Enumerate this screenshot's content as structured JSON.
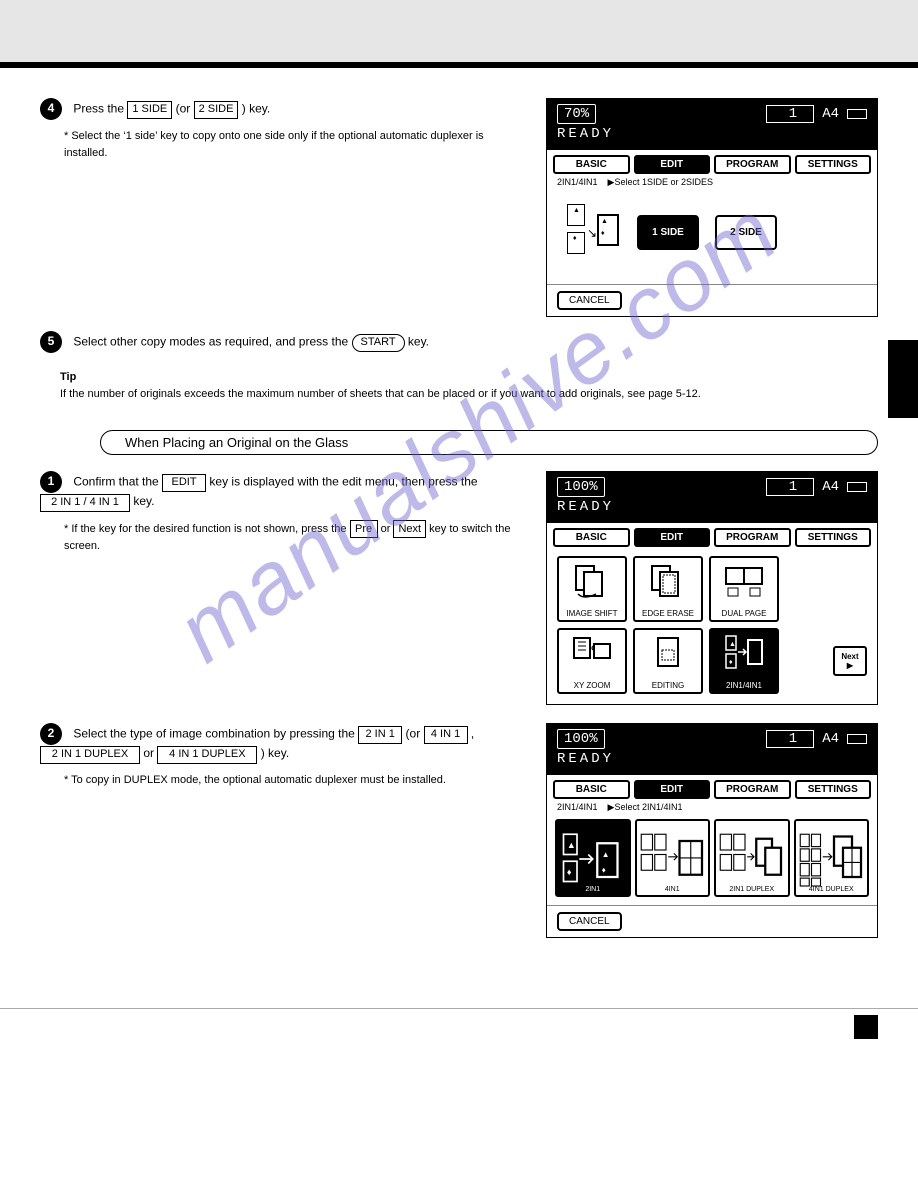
{
  "watermark": "manualshive.com",
  "header": {},
  "panel1": {
    "zoom": "70%",
    "count": "1",
    "paper": "A4",
    "ready": "READY",
    "tabs": {
      "basic": "BASIC",
      "edit": "EDIT",
      "program": "PROGRAM",
      "settings": "SETTINGS"
    },
    "mode_label": "2IN1/4IN1",
    "prompt": "▶Select 1SIDE or 2SIDES",
    "side1": "1 SIDE",
    "side2": "2 SIDE",
    "cancel": "CANCEL"
  },
  "panel2": {
    "zoom": "100%",
    "count": "1",
    "paper": "A4",
    "ready": "READY",
    "tabs": {
      "basic": "BASIC",
      "edit": "EDIT",
      "program": "PROGRAM",
      "settings": "SETTINGS"
    },
    "items": {
      "image_shift": "IMAGE SHIFT",
      "edge_erase": "EDGE ERASE",
      "dual_page": "DUAL PAGE",
      "xy_zoom": "XY ZOOM",
      "editing": "EDITING",
      "n2in1": "2IN1/4IN1"
    },
    "next": "Next"
  },
  "panel3": {
    "zoom": "100%",
    "count": "1",
    "paper": "A4",
    "ready": "READY",
    "tabs": {
      "basic": "BASIC",
      "edit": "EDIT",
      "program": "PROGRAM",
      "settings": "SETTINGS"
    },
    "mode_label": "2IN1/4IN1",
    "prompt": "▶Select 2IN1/4IN1",
    "modes": {
      "m2in1": "2IN1",
      "m4in1": "4IN1",
      "m2in1d": "2IN1 DUPLEX",
      "m4in1d": "4IN1 DUPLEX"
    },
    "cancel": "CANCEL"
  },
  "text": {
    "step4_a": "Press the ",
    "step4_key1": "1 SIDE",
    "step4_b": " (or ",
    "step4_key2": "2 SIDE",
    "step4_c": " ) key.",
    "step4_note": "* Select the ‘1 side’ key to copy onto one side only if the optional automatic duplexer is installed.",
    "step5_a": "Select other copy modes as required, and press the ",
    "step5_key": "START",
    "step5_b": " key.",
    "tip_head": "Tip",
    "tip_body": "If the number of originals exceeds the maximum number of sheets that can be placed or if you want to add originals, see page 5-12.",
    "subhead": "When Placing an Original on the Glass",
    "step1_a": "Confirm that the ",
    "step1_key1": "EDIT",
    "step1_b": " key is displayed with the edit menu, then press the ",
    "step1_key2": "2 IN 1 / 4 IN 1",
    "step1_c": " key.",
    "step1_note_a": "* If the key for the desired function is not shown, press the ",
    "step1_note_key1": "Pre",
    "step1_note_b": " or ",
    "step1_note_key2": "Next",
    "step1_note_c": " key to switch the screen.",
    "step2_a": "Select the type of image combination by pressing the ",
    "step2_key1": "2 IN 1",
    "step2_b": " (or ",
    "step2_key2": "4 IN 1",
    "step2_c": " , ",
    "step2_key3": "2 IN 1 DUPLEX",
    "step2_d": " or ",
    "step2_key4": "4 IN 1 DUPLEX",
    "step2_e": " ) key.",
    "step2_note": "* To copy in DUPLEX mode, the optional automatic duplexer must be installed."
  },
  "step_nums": {
    "s4": "4",
    "s5": "5",
    "s1": "1",
    "s2": "2"
  }
}
